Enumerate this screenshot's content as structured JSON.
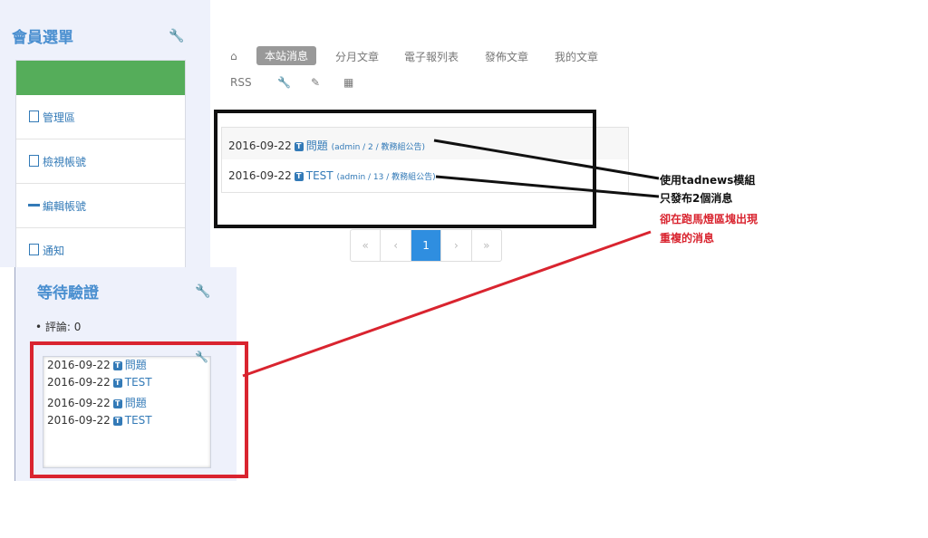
{
  "member": {
    "title": "會員選單",
    "items": [
      {
        "label": "管理區"
      },
      {
        "label": "檢視帳號"
      },
      {
        "label": "編輯帳號"
      },
      {
        "label": "通知"
      }
    ]
  },
  "pending": {
    "title": "等待驗證",
    "comment": "評論: 0"
  },
  "marquee": {
    "items": [
      {
        "date": "2016-09-22",
        "title": "問題"
      },
      {
        "date": "2016-09-22",
        "title": "TEST"
      },
      {
        "date": "2016-09-22",
        "title": "問題"
      },
      {
        "date": "2016-09-22",
        "title": "TEST"
      }
    ]
  },
  "nav": {
    "active": "本站消息",
    "items": [
      "分月文章",
      "電子報列表",
      "發佈文章",
      "我的文章"
    ],
    "rss": "RSS"
  },
  "news": [
    {
      "date": "2016-09-22",
      "title": "問題",
      "meta": "(admin / 2 / 教務組公告)"
    },
    {
      "date": "2016-09-22",
      "title": "TEST",
      "meta": "(admin / 13 / 教務組公告)"
    }
  ],
  "pager": {
    "first": "«",
    "prev": "‹",
    "current": "1",
    "next": "›",
    "last": "»"
  },
  "notes": {
    "line1": "使用tadnews模組",
    "line2": "只發布2個消息",
    "line3": "卻在跑馬燈區塊出現",
    "line4": "重複的消息"
  },
  "colors": {
    "annotation_red": "#d9242f",
    "link_blue": "#337ab7",
    "active_page": "#2f8ee0",
    "menu_green": "#55ad5a"
  }
}
